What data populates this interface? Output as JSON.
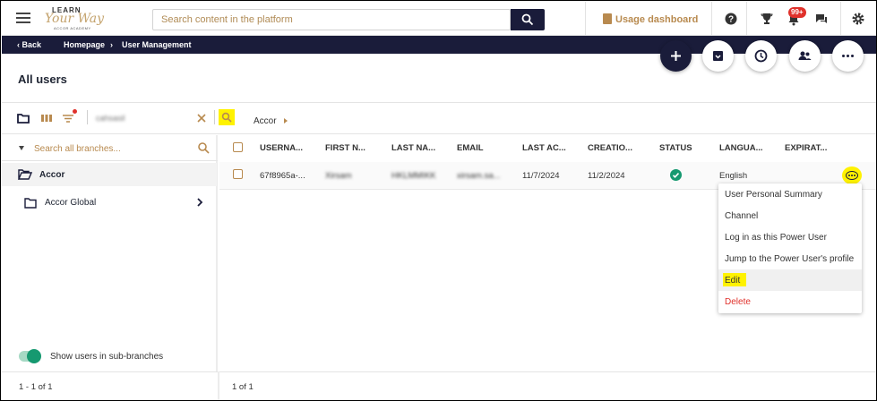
{
  "header": {
    "logo": {
      "line1": "LEARN",
      "line2": "Your Way",
      "line3": "ACCOR ACADEMY"
    },
    "search_placeholder": "Search content in the platform",
    "usage_dashboard_label": "Usage dashboard",
    "notifications_badge": "99+",
    "icons": [
      "menu-icon",
      "search-icon",
      "clipboard-icon",
      "help-icon",
      "trophy-icon",
      "bell-icon",
      "chat-icon",
      "gear-icon"
    ]
  },
  "breadcrumb": {
    "back_label": "Back",
    "items": [
      "Homepage",
      "User Management"
    ]
  },
  "page": {
    "title": "All users",
    "action_icons": [
      "plus-icon",
      "archive-icon",
      "clock-icon",
      "users-icon",
      "more-icon"
    ]
  },
  "left_panel": {
    "search_value": "cahsasil",
    "branch_search_placeholder": "Search all branches...",
    "tree": [
      {
        "label": "Accor",
        "selected": true
      },
      {
        "label": "Accor Global",
        "selected": false
      }
    ],
    "toggle_label": "Show users in sub-branches",
    "toggle_on": true,
    "pagination": "1 - 1 of 1"
  },
  "right_breadcrumb": "Accor",
  "table": {
    "columns": [
      "USERNA...",
      "FIRST N...",
      "LAST NA...",
      "EMAIL",
      "LAST AC...",
      "CREATIO...",
      "STATUS",
      "LANGUA...",
      "EXPIRAT..."
    ],
    "rows": [
      {
        "username": "67f8965a-...",
        "first_name": "Xirsam",
        "last_name": "HKLMMIKK",
        "email": "xirsam.sa...",
        "last_access": "11/7/2024",
        "creation": "11/2/2024",
        "status": "active",
        "language": "English",
        "expiration": ""
      }
    ],
    "pagination": "1 of 1"
  },
  "context_menu": {
    "items": [
      "User Personal Summary",
      "Channel",
      "Log in as this Power User",
      "Jump to the Power User's profile",
      "Edit",
      "Delete"
    ],
    "highlighted": "Edit"
  },
  "colors": {
    "navy": "#1a1c3a",
    "gold": "#b88a4f",
    "success": "#169970",
    "danger": "#e0312b",
    "highlight": "#fff200"
  }
}
